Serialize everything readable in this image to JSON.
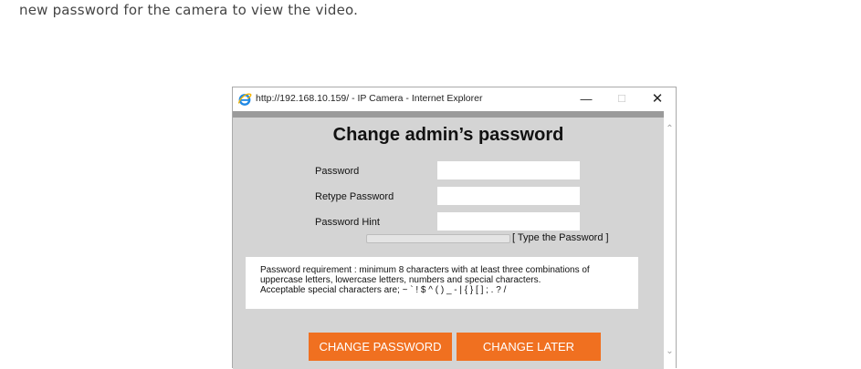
{
  "intro_text": "new password for the camera to view the video.",
  "window": {
    "title": "http://192.168.10.159/ - IP Camera - Internet Explorer",
    "minimize_glyph": "—",
    "maximize_glyph": "☐",
    "close_glyph": "✕",
    "browser_icon": "internet-explorer-icon"
  },
  "form": {
    "heading": "Change admin’s password",
    "fields": [
      {
        "label": "Password",
        "value": ""
      },
      {
        "label": "Retype Password",
        "value": ""
      },
      {
        "label": "Password Hint",
        "value": ""
      }
    ],
    "strength": {
      "text": "[ Type the Password ]",
      "level": 0
    },
    "requirement": [
      "Password requirement : minimum 8 characters with at least three combinations of",
      "uppercase letters, lowercase letters, numbers and special characters.",
      "Acceptable special characters are; ~ ` ! $ ^ ( ) _ - | { } [ ] ; . ? /"
    ],
    "buttons": {
      "change_password": "CHANGE PASSWORD",
      "change_later": "CHANGE LATER"
    }
  },
  "colors": {
    "accent_button": "#f07020",
    "panel_background": "#d4d4d4"
  }
}
